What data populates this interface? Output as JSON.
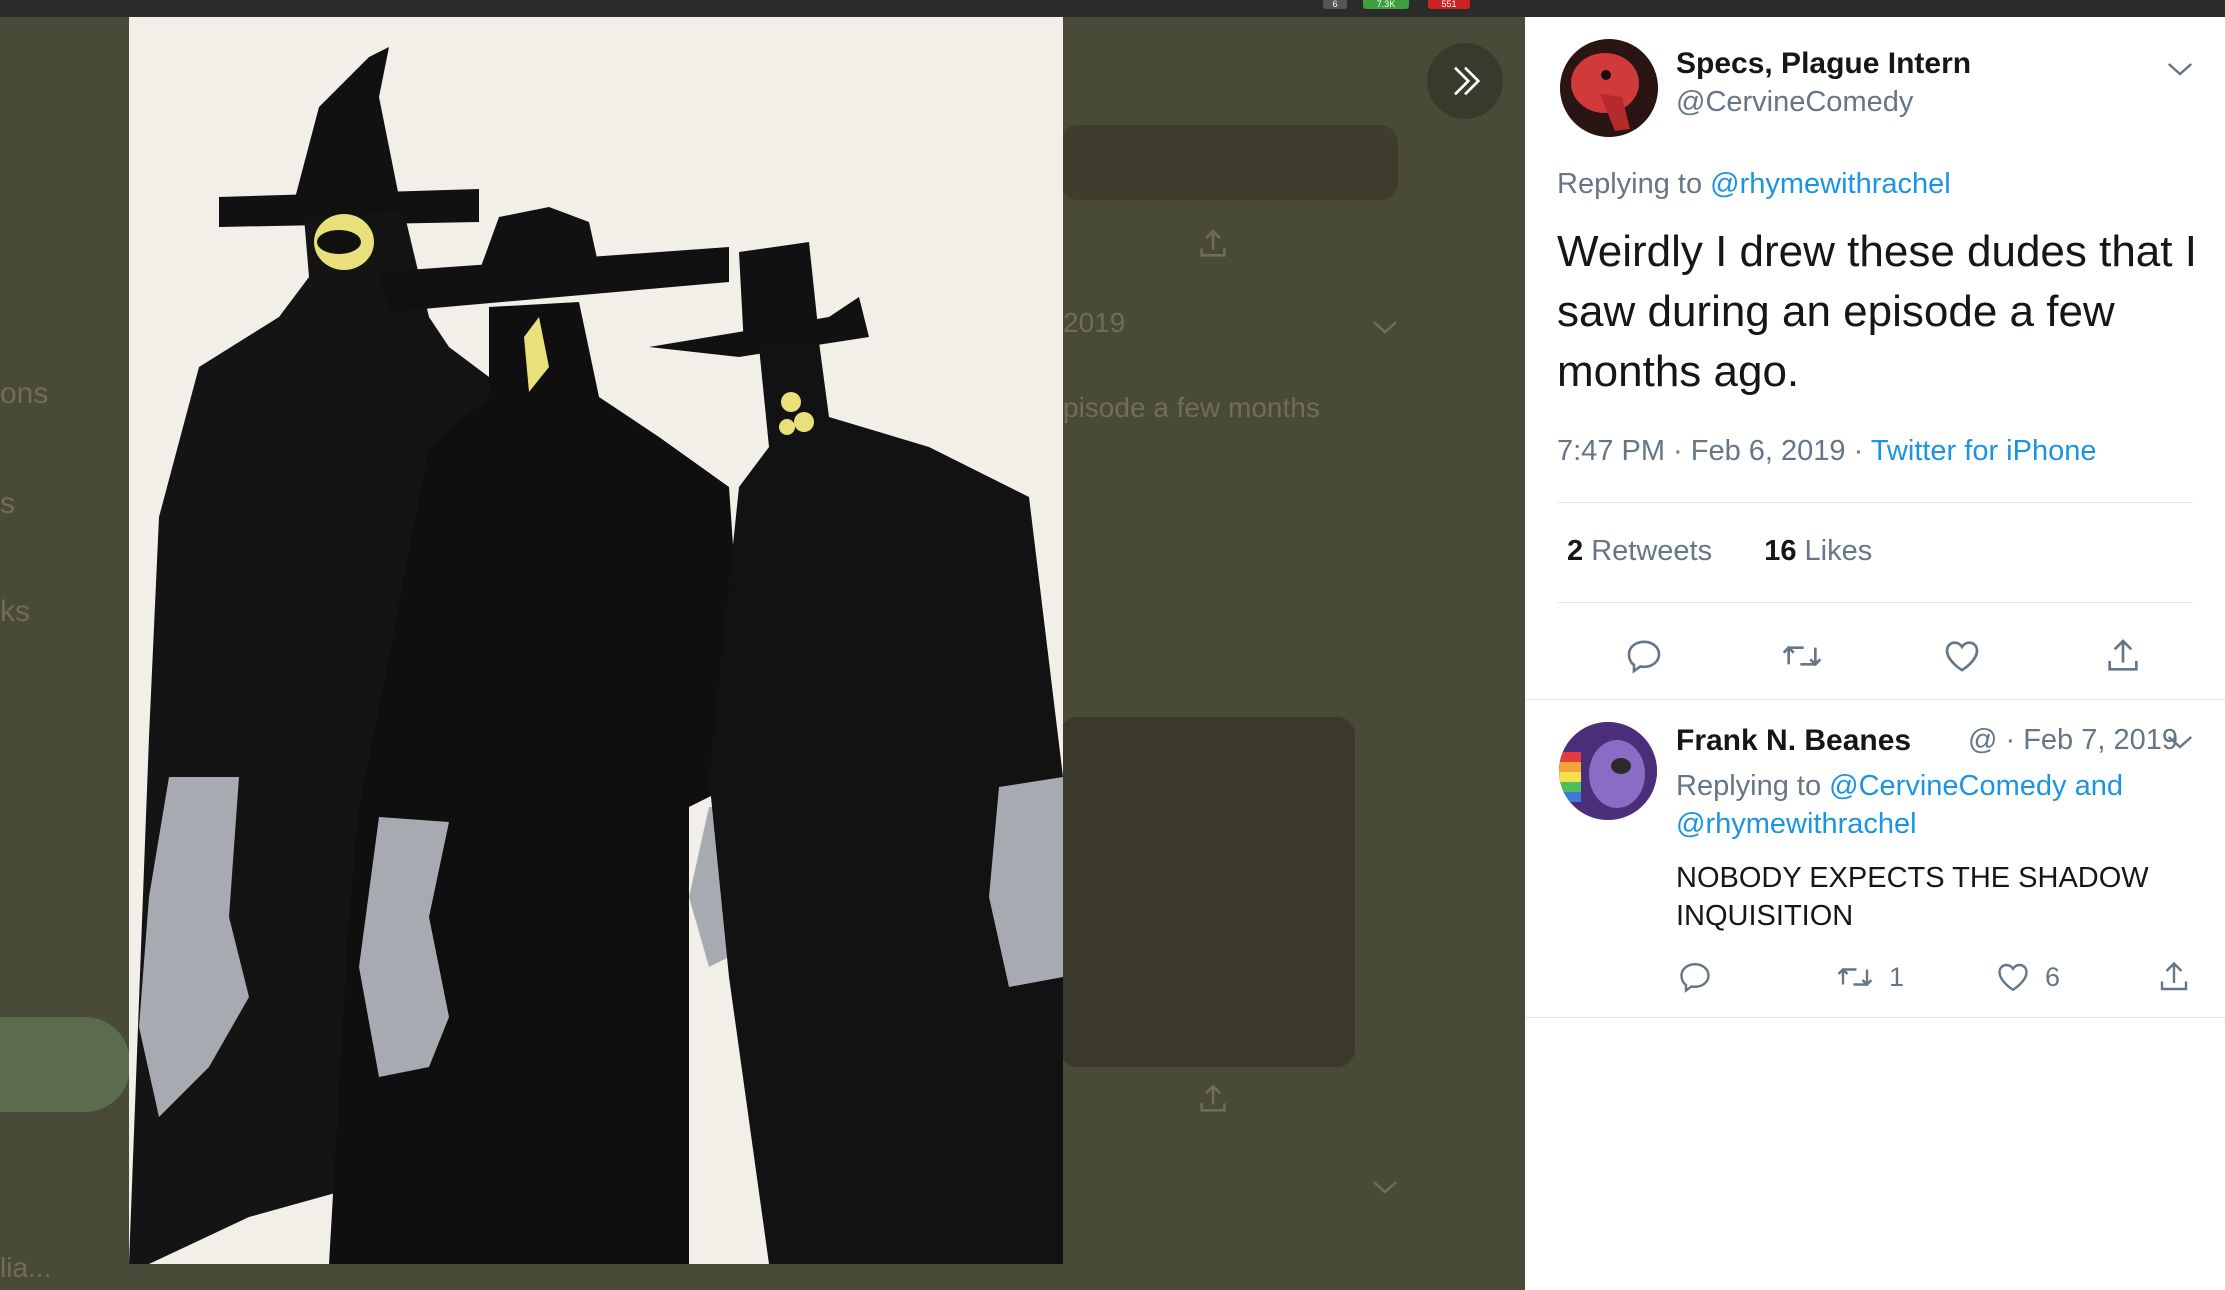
{
  "browser": {
    "badges": [
      {
        "text": "6",
        "color": "#555555"
      },
      {
        "text": "7.3K",
        "color": "#3f9f3f"
      },
      {
        "text": "551",
        "color": "#cc2222"
      }
    ]
  },
  "background": {
    "snippets": [
      "ons",
      "s",
      "ks",
      "2019",
      "pisode a few months",
      "lia..."
    ]
  },
  "lightbox": {
    "expand_icon": "double-chevron-right-icon"
  },
  "tweet": {
    "author_name": "Specs, Plague Intern",
    "author_handle": "@CervineComedy",
    "replying_prefix": "Replying to ",
    "replying_to": "@rhymewithrachel",
    "text": "Weirdly I drew these dudes that I saw during an episode a few months ago.",
    "time": "7:47 PM · Feb 6, 2019 · ",
    "source": "Twitter for iPhone",
    "retweets_count": "2",
    "retweets_label": " Retweets",
    "likes_count": "16",
    "likes_label": " Likes",
    "actions": [
      "reply-icon",
      "retweet-icon",
      "like-icon",
      "share-icon"
    ]
  },
  "reply": {
    "author_name": "Frank N. Beanes",
    "meta": "@ · Feb 7, 2019",
    "replying_prefix": "Replying to ",
    "replying_to": "@CervineComedy and @rhymewithrachel",
    "text": "NOBODY EXPECTS THE SHADOW INQUISITION",
    "retweet_count": "1",
    "like_count": "6"
  },
  "colors": {
    "link": "#1b95e0",
    "secondary_text": "#657786",
    "primary_text": "#14171a"
  }
}
